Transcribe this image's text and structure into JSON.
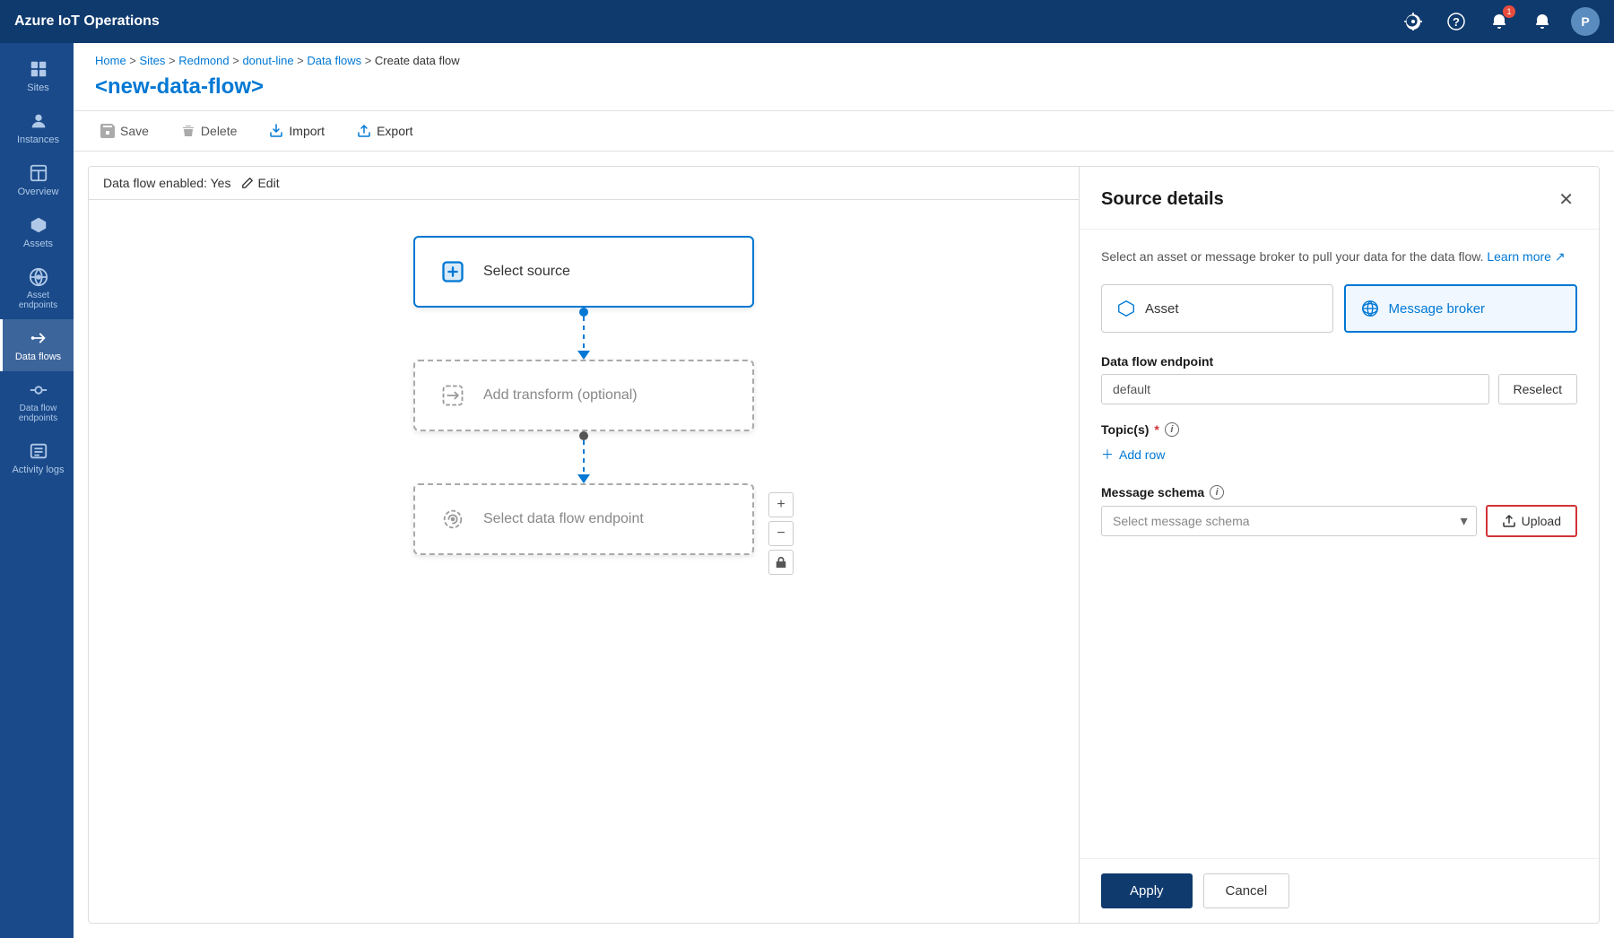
{
  "app": {
    "title": "Azure IoT Operations"
  },
  "nav_icons": {
    "settings": "⚙",
    "help": "?",
    "notification": "🔔",
    "notification_count": "1",
    "alert": "🔔",
    "user_initial": "P"
  },
  "sidebar": {
    "items": [
      {
        "id": "sites",
        "label": "Sites",
        "icon": "sites"
      },
      {
        "id": "instances",
        "label": "Instances",
        "icon": "instances"
      },
      {
        "id": "overview",
        "label": "Overview",
        "icon": "overview"
      },
      {
        "id": "assets",
        "label": "Assets",
        "icon": "assets"
      },
      {
        "id": "asset-endpoints",
        "label": "Asset endpoints",
        "icon": "asset-endpoints"
      },
      {
        "id": "data-flows",
        "label": "Data flows",
        "icon": "data-flows",
        "active": true
      },
      {
        "id": "data-flow-endpoints",
        "label": "Data flow endpoints",
        "icon": "data-flow-endpoints"
      },
      {
        "id": "activity-logs",
        "label": "Activity logs",
        "icon": "activity-logs"
      }
    ]
  },
  "breadcrumb": {
    "items": [
      "Home",
      "Sites",
      "Redmond",
      "donut-line",
      "Data flows",
      "Create data flow"
    ]
  },
  "page_title": "<new-data-flow>",
  "toolbar": {
    "save_label": "Save",
    "delete_label": "Delete",
    "import_label": "Import",
    "export_label": "Export"
  },
  "flow": {
    "enabled_label": "Data flow enabled: Yes",
    "edit_label": "Edit",
    "nodes": {
      "source": "Select source",
      "transform": "Add transform (optional)",
      "endpoint": "Select data flow endpoint"
    }
  },
  "panel": {
    "title": "Source details",
    "description": "Select an asset or message broker to pull your data for the data flow.",
    "learn_more": "Learn more",
    "source_types": [
      {
        "id": "asset",
        "label": "Asset"
      },
      {
        "id": "message-broker",
        "label": "Message broker",
        "active": true
      }
    ],
    "endpoint_label": "Data flow endpoint",
    "endpoint_placeholder": "default",
    "reselect_label": "Reselect",
    "topics_label": "Topic(s)",
    "add_row_label": "Add row",
    "schema_label": "Message schema",
    "schema_placeholder": "Select message schema",
    "upload_label": "Upload",
    "apply_label": "Apply",
    "cancel_label": "Cancel"
  }
}
